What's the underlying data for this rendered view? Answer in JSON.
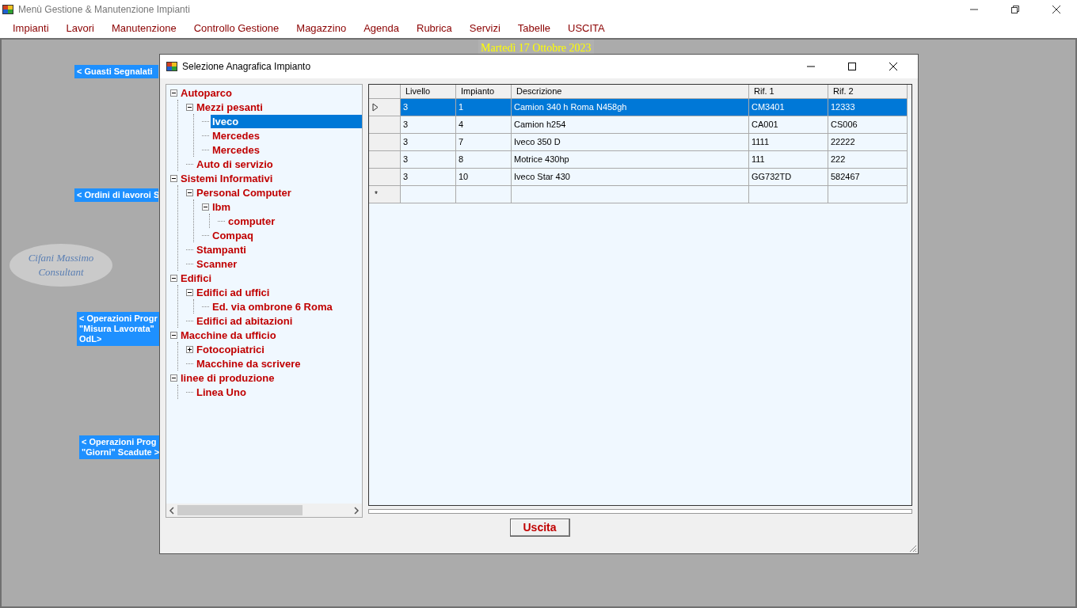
{
  "window": {
    "title": "Menù Gestione & Manutenzione Impianti"
  },
  "menu": [
    "Impianti",
    "Lavori",
    "Manutenzione",
    "Controllo Gestione",
    "Magazzino",
    "Agenda",
    "Rubrica",
    "Servizi",
    "Tabelle",
    "USCITA"
  ],
  "date": "Martedì 17 Ottobre 2023",
  "side_buttons": [
    {
      "lines": [
        "< Guasti Segnalati"
      ]
    },
    {
      "lines": [
        "< Ordini di lavoroi S"
      ]
    },
    {
      "lines": [
        "< Operazioni Progr",
        "\"Misura Lavorata\"",
        "OdL>"
      ]
    },
    {
      "lines": [
        "< Operazioni Prog",
        "\"Giorni\" Scadute >"
      ]
    }
  ],
  "logo": {
    "lines": [
      "Cifani Massimo",
      "Consultant"
    ]
  },
  "dialog": {
    "title": "Selezione Anagrafica Impianto",
    "tree": [
      {
        "label": "Autoparco",
        "expanded": true,
        "selected": false,
        "children": [
          {
            "label": "Mezzi pesanti",
            "expanded": true,
            "selected": false,
            "children": [
              {
                "label": "Iveco",
                "selected": true
              },
              {
                "label": "Mercedes",
                "selected": false
              },
              {
                "label": "Mercedes",
                "selected": false
              }
            ]
          },
          {
            "label": "Auto di servizio",
            "selected": false
          }
        ]
      },
      {
        "label": "Sistemi Informativi",
        "expanded": true,
        "selected": false,
        "children": [
          {
            "label": "Personal Computer",
            "expanded": true,
            "selected": false,
            "children": [
              {
                "label": "Ibm",
                "expanded": true,
                "selected": false,
                "children": [
                  {
                    "label": "computer",
                    "selected": false
                  }
                ]
              },
              {
                "label": "Compaq",
                "selected": false
              }
            ]
          },
          {
            "label": "Stampanti",
            "selected": false
          },
          {
            "label": "Scanner",
            "selected": false
          }
        ]
      },
      {
        "label": "Edifici",
        "expanded": true,
        "selected": false,
        "children": [
          {
            "label": "Edifici ad uffici",
            "expanded": true,
            "selected": false,
            "children": [
              {
                "label": "Ed. via ombrone 6 Roma",
                "selected": false
              }
            ]
          },
          {
            "label": "Edifici ad abitazioni",
            "selected": false
          }
        ]
      },
      {
        "label": "Macchine da ufficio",
        "expanded": true,
        "selected": false,
        "children": [
          {
            "label": "Fotocopiatrici",
            "expanded": false,
            "selected": false
          },
          {
            "label": "Macchine da scrivere",
            "selected": false
          }
        ]
      },
      {
        "label": "linee di produzione",
        "expanded": true,
        "selected": false,
        "children": [
          {
            "label": "Linea Uno",
            "selected": false
          }
        ]
      }
    ],
    "table": {
      "columns": [
        "Livello",
        "Impianto",
        "Descrizione",
        "Rif. 1",
        "Rif. 2"
      ],
      "rows": [
        {
          "cells": [
            "3",
            "1",
            "Camion 340 h Roma N458gh",
            "CM3401",
            "12333"
          ],
          "selected": true
        },
        {
          "cells": [
            "3",
            "4",
            "Camion h254",
            "CA001",
            "CS006"
          ],
          "selected": false
        },
        {
          "cells": [
            "3",
            "7",
            "Iveco 350 D",
            "1111",
            "22222"
          ],
          "selected": false
        },
        {
          "cells": [
            "3",
            "8",
            "Motrice 430hp",
            "111",
            "222"
          ],
          "selected": false
        },
        {
          "cells": [
            "3",
            "10",
            "Iveco Star 430",
            "GG732TD",
            "582467"
          ],
          "selected": false
        }
      ],
      "new_row_marker": "*"
    },
    "button": "Uscita"
  }
}
